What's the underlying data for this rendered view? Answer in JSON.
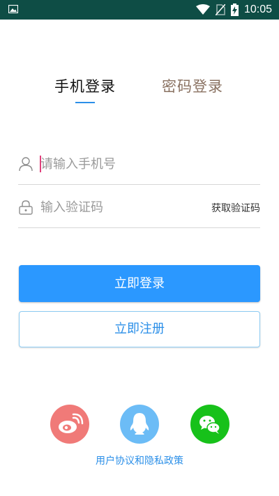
{
  "status_bar": {
    "time": "10:05",
    "icons": [
      "image-icon",
      "wifi-icon",
      "no-sim-icon",
      "battery-charging-icon"
    ]
  },
  "tabs": {
    "phone_login": "手机登录",
    "password_login": "密码登录",
    "active": "phone_login"
  },
  "form": {
    "phone_placeholder": "请输入手机号",
    "phone_value": "",
    "code_placeholder": "输入验证码",
    "code_value": "",
    "get_code_label": "获取验证码"
  },
  "buttons": {
    "login_label": "立即登录",
    "register_label": "立即注册"
  },
  "social": {
    "items": [
      "weibo-icon",
      "qq-icon",
      "wechat-icon"
    ]
  },
  "footer": {
    "policy_link": "用户协议和隐私政策"
  },
  "colors": {
    "status_bar_bg": "#0e4d45",
    "accent": "#2b98ff",
    "password_tab_text": "#8a7262",
    "weibo_bg": "#f07a78",
    "qq_bg": "#6cbcf6",
    "wechat_bg": "#17c11a"
  }
}
